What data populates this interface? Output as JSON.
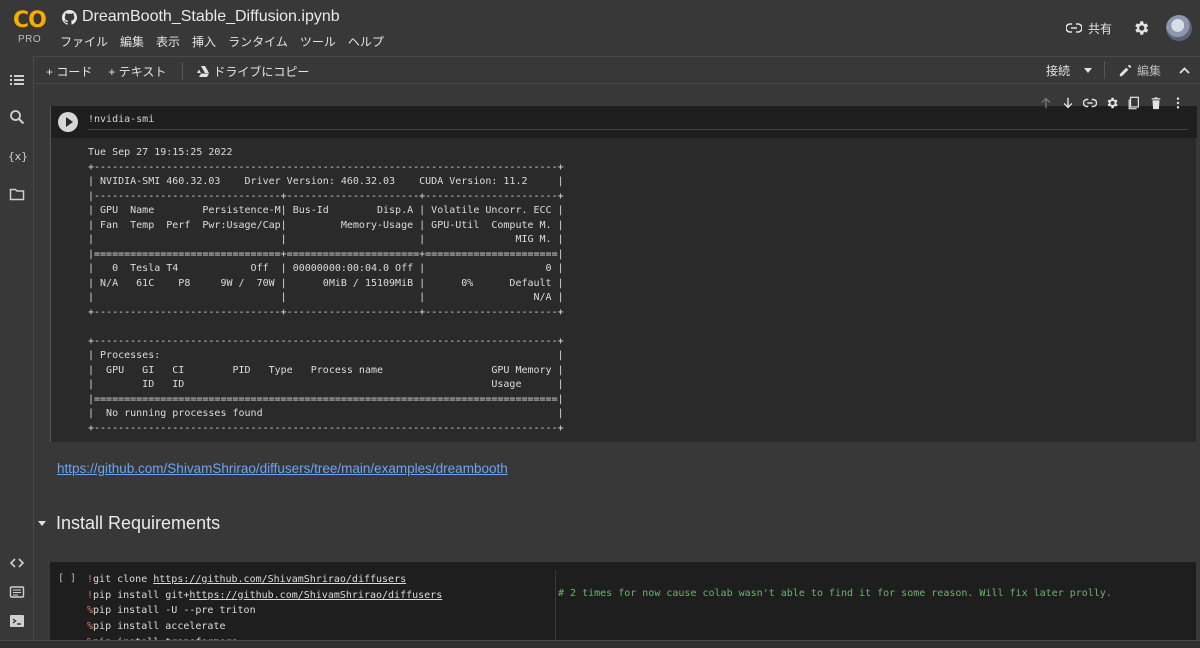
{
  "app": {
    "logo_text": "CO",
    "logo_badge": "PRO",
    "notebook_title": "DreamBooth_Stable_Diffusion.ipynb"
  },
  "menu": [
    "ファイル",
    "編集",
    "表示",
    "挿入",
    "ランタイム",
    "ツール",
    "ヘルプ"
  ],
  "header_right": {
    "share_label": "共有"
  },
  "toolbar": {
    "add_code": "+ コード",
    "add_text": "+ テキスト",
    "copy_drive": "ドライブにコピー",
    "connect": "接続",
    "edit": "編集"
  },
  "cell1": {
    "code": "!nvidia-smi",
    "output": [
      "Tue Sep 27 19:15:25 2022",
      "+-----------------------------------------------------------------------------+",
      "| NVIDIA-SMI 460.32.03    Driver Version: 460.32.03    CUDA Version: 11.2     |",
      "|-------------------------------+----------------------+----------------------+",
      "| GPU  Name        Persistence-M| Bus-Id        Disp.A | Volatile Uncorr. ECC |",
      "| Fan  Temp  Perf  Pwr:Usage/Cap|         Memory-Usage | GPU-Util  Compute M. |",
      "|                               |                      |               MIG M. |",
      "|===============================+======================+======================|",
      "|   0  Tesla T4            Off  | 00000000:00:04.0 Off |                    0 |",
      "| N/A   61C    P8     9W /  70W |      0MiB / 15109MiB |      0%      Default |",
      "|                               |                      |                  N/A |",
      "+-------------------------------+----------------------+----------------------+",
      "",
      "+-----------------------------------------------------------------------------+",
      "| Processes:                                                                  |",
      "|  GPU   GI   CI        PID   Type   Process name                  GPU Memory |",
      "|        ID   ID                                                   Usage      |",
      "|=============================================================================|",
      "|  No running processes found                                                 |",
      "+-----------------------------------------------------------------------------+"
    ]
  },
  "text_cell": {
    "link": "https://github.com/ShivamShrirao/diffusers/tree/main/examples/dreambooth",
    "heading": "Install Requirements"
  },
  "cell2": {
    "bracket": "[ ]",
    "lines": [
      {
        "prefix": "!",
        "cmd": "git clone ",
        "url": "https://github.com/ShivamShrirao/diffusers"
      },
      {
        "prefix": "!",
        "cmd": "pip install git+",
        "url": "https://github.com/ShivamShrirao/diffusers"
      },
      {
        "prefix": "%",
        "cmd": "pip install -U --pre triton",
        "url": ""
      },
      {
        "prefix": "%",
        "cmd": "pip install accelerate",
        "url": ""
      },
      {
        "prefix": "%",
        "cmd": "pip install transformers",
        "url": ""
      }
    ],
    "comment": "# 2 times for now cause colab wasn't able to find it for some reason. Will fix later prolly."
  },
  "icons": {
    "rail": [
      "toc-icon",
      "search-icon",
      "variables-icon",
      "folder-icon",
      "code-snippets-icon",
      "command-palette-icon",
      "terminal-icon"
    ],
    "cell_tools": [
      "move-up-icon",
      "move-down-icon",
      "link-icon",
      "cell-settings-icon",
      "mirror-cell-icon",
      "delete-icon",
      "more-icon"
    ]
  },
  "colors": {
    "background": "#383838",
    "cell_bg": "#1e1e1e",
    "link": "#6ba5f6",
    "comment": "#6bb36b",
    "magic": "#e07a5f",
    "logo": "#f9ab00"
  }
}
